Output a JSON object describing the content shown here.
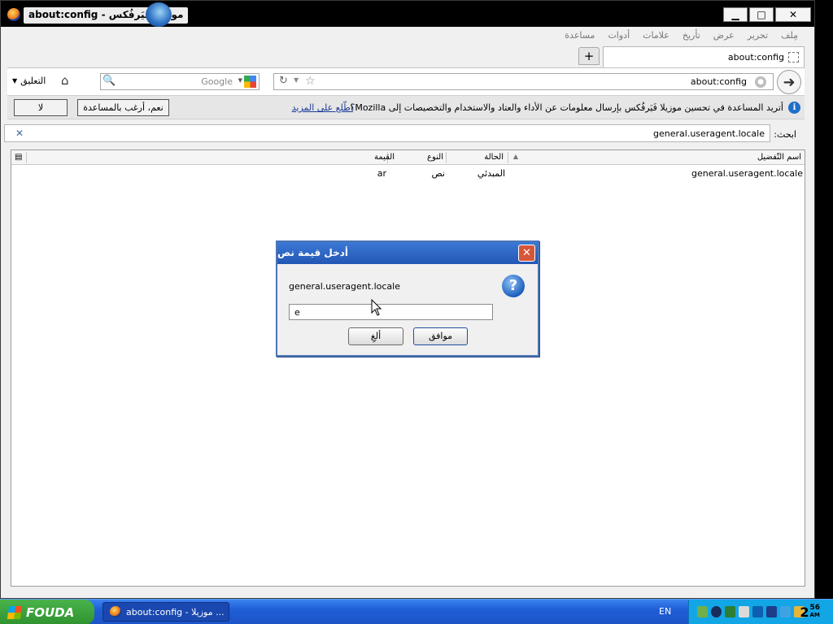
{
  "window": {
    "title": "about:config - موزيلا فَيَرفُكس",
    "buttons": {
      "minimize": "▁",
      "maximize": "□",
      "close": "✕"
    }
  },
  "menubar": {
    "items": [
      "مِلف",
      "تحرير",
      "عرض",
      "تأريخ",
      "علامات",
      "أدوات",
      "مساعدة"
    ]
  },
  "tabs": [
    {
      "label": "about:config"
    }
  ],
  "newtab_label": "+",
  "navbar": {
    "back_glyph": "➜",
    "url": "about:config",
    "search_placeholder": "Google",
    "bookmarks_label": "التعليق",
    "bookmarks_arrow": "▼"
  },
  "notification": {
    "info_glyph": "i",
    "text": "أتريد المساعدة في تحسين موزيلا فَيَرفُكس بإرسال معلومات عن الأداء والعتاد والاستخدام والتخصيصات إلى Mozilla؟",
    "link": "اطّلع على المزيد",
    "yes_button": "نعم، أرغب بالمساعدة",
    "no_button": "لا"
  },
  "filter": {
    "label": "ابحث:",
    "value": "general.useragent.locale",
    "clear": "✕"
  },
  "prefs": {
    "columns": {
      "name": "اسم التّفضيل",
      "status": "الحالة",
      "type": "النوع",
      "value": "القيمة"
    },
    "rows": [
      {
        "name": "general.useragent.locale",
        "status": "المبدئي",
        "type": "نص",
        "value": "ar"
      }
    ]
  },
  "dialog": {
    "title": "أدخل قيمة نص",
    "close": "✕",
    "pref_name": "general.useragent.locale",
    "question_glyph": "?",
    "input_value": "e",
    "ok_button": "موافق",
    "cancel_button": "ألغِ"
  },
  "taskbar": {
    "start_label": "FOUDA",
    "items": [
      {
        "label": "about:config - موزيلا ..."
      }
    ],
    "language": "EN",
    "clock": {
      "hour": "2",
      "minutes": "56",
      "ampm": "AM"
    }
  },
  "colors": {
    "dialog_title_bg": "#2356b5",
    "taskbar_bg": "#1f5ed6",
    "tray_bg": "#12a6e6",
    "start_bg": "#2f922f",
    "link": "#1a3a9a"
  }
}
